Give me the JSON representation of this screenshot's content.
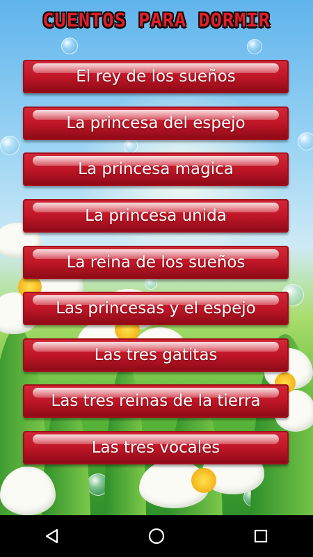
{
  "app": {
    "title": "CUENTOS PARA DORMIR"
  },
  "stories": [
    {
      "label": "El rey de los sueños"
    },
    {
      "label": "La princesa del espejo"
    },
    {
      "label": "La princesa magica"
    },
    {
      "label": "La princesa unida"
    },
    {
      "label": "La reina de los sueños"
    },
    {
      "label": "Las princesas y el espejo"
    },
    {
      "label": "Las tres gatitas"
    },
    {
      "label": "Las tres reinas de la tierra"
    },
    {
      "label": "Las tres vocales"
    }
  ],
  "navbar": {
    "back_icon": "back-triangle-icon",
    "home_icon": "home-circle-icon",
    "recents_icon": "recents-square-icon"
  },
  "colors": {
    "button_red": "#c01627",
    "title_red": "#e3202a",
    "sky": "#7fc4ef"
  }
}
